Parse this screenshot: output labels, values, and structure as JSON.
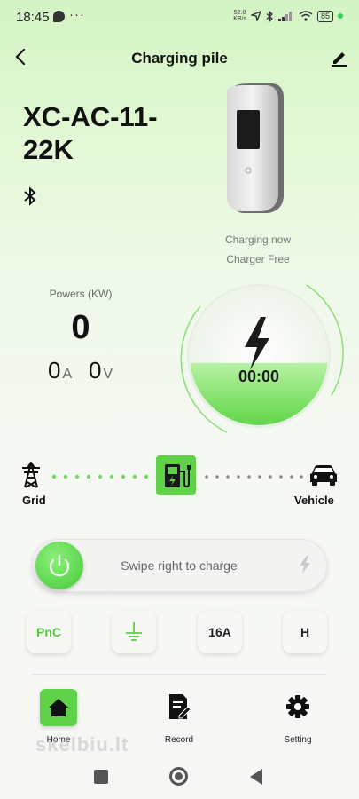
{
  "status_bar": {
    "time": "18:45",
    "dots": "···",
    "net_speed_value": "52.0",
    "net_speed_unit": "KB/s",
    "battery": "85"
  },
  "header": {
    "title": "Charging pile"
  },
  "device": {
    "model": "XC-AC-11-22K",
    "status": "Charging now",
    "charger_state": "Charger Free"
  },
  "readings": {
    "powers_label": "Powers (KW)",
    "power_value": "0",
    "current_value": "0",
    "current_unit": "A",
    "voltage_value": "0",
    "voltage_unit": "V"
  },
  "gauge": {
    "timer": "00:00",
    "fill_fraction": 0.45
  },
  "flow": {
    "grid_label": "Grid",
    "vehicle_label": "Vehicle"
  },
  "swipe": {
    "text": "Swipe right to charge"
  },
  "options": {
    "pnc": "PnC",
    "current": "16A",
    "mode": "H"
  },
  "bottom_nav": {
    "home": "Home",
    "record": "Record",
    "setting": "Setting"
  },
  "watermark": "skelbiu.lt",
  "colors": {
    "accent_green": "#5fd24a",
    "text_dark": "#111111"
  }
}
